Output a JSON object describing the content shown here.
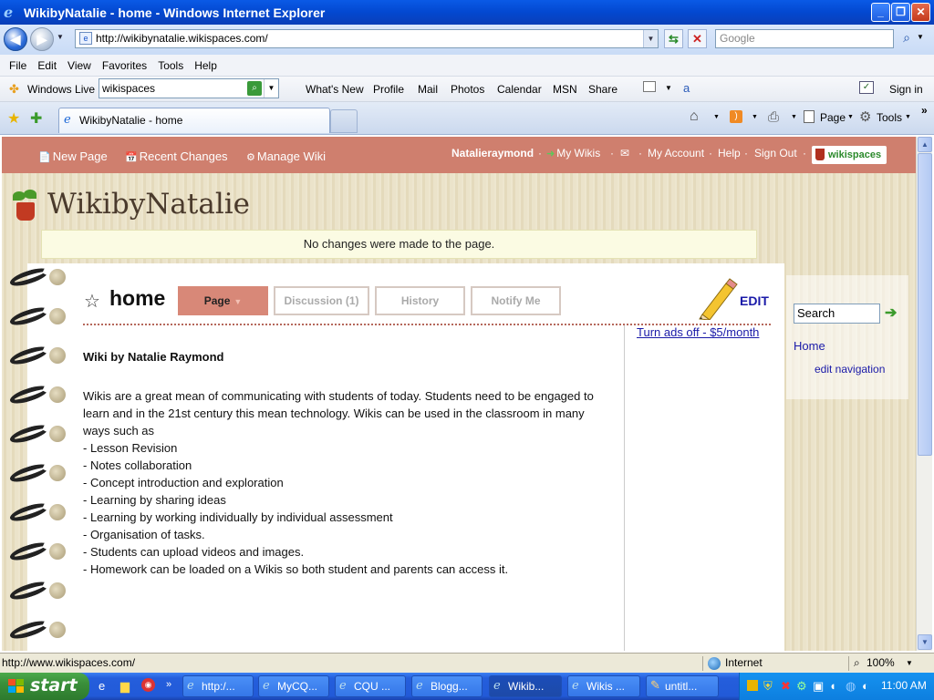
{
  "window": {
    "title": "WikibyNatalie - home - Windows Internet Explorer"
  },
  "address": {
    "url": "http://wikibynatalie.wikispaces.com/",
    "search_placeholder": "Google"
  },
  "menu": [
    "File",
    "Edit",
    "View",
    "Favorites",
    "Tools",
    "Help"
  ],
  "links_bar": {
    "live_label": "Windows Live",
    "search_value": "wikispaces",
    "items": [
      "What's New",
      "Profile",
      "Mail",
      "Photos",
      "Calendar",
      "MSN",
      "Share"
    ],
    "sign_in": "Sign in"
  },
  "tabs": {
    "active": "WikibyNatalie - home"
  },
  "command_bar": {
    "page": "Page",
    "tools": "Tools"
  },
  "wikispaces": {
    "new_page": "New Page",
    "recent_changes": "Recent Changes",
    "manage_wiki": "Manage Wiki",
    "username": "Natalieraymond",
    "my_wikis": "My Wikis",
    "my_account": "My Account",
    "help": "Help",
    "sign_out": "Sign Out",
    "logo": "wikispaces",
    "separator": "·"
  },
  "site": {
    "title": "WikibyNatalie",
    "notice": "No changes were made to the page."
  },
  "page": {
    "name": "home",
    "tabs": [
      "Page",
      "Discussion (1)",
      "History",
      "Notify Me"
    ],
    "edit": "EDIT",
    "ads_off": "Turn ads off - $5/month",
    "heading": "Wiki by Natalie Raymond",
    "intro": "Wikis are a great mean of communicating with students of today. Students need to be engaged to learn and in the 21st century this mean technology. Wikis can be used in the classroom in many ways such as",
    "list": [
      "- Lesson Revision",
      "- Notes collaboration",
      "- Concept introduction and exploration",
      "- Learning by sharing ideas",
      "- Learning by working individually by individual assessment",
      "- Organisation of tasks.",
      "- Students can upload videos and images.",
      "- Homework can be loaded on a Wikis so both student and parents can access it."
    ]
  },
  "sidebar": {
    "search_value": "Search",
    "home": "Home",
    "edit_navigation": "edit navigation"
  },
  "status": {
    "url": "http://www.wikispaces.com/",
    "zone": "Internet",
    "zoom": "100%"
  },
  "taskbar": {
    "start": "start",
    "items": [
      "http:/...",
      "MyCQ...",
      "CQU ...",
      "Blogg...",
      "Wikib...",
      "Wikis ...",
      "untitl..."
    ],
    "time": "11:00 AM"
  }
}
